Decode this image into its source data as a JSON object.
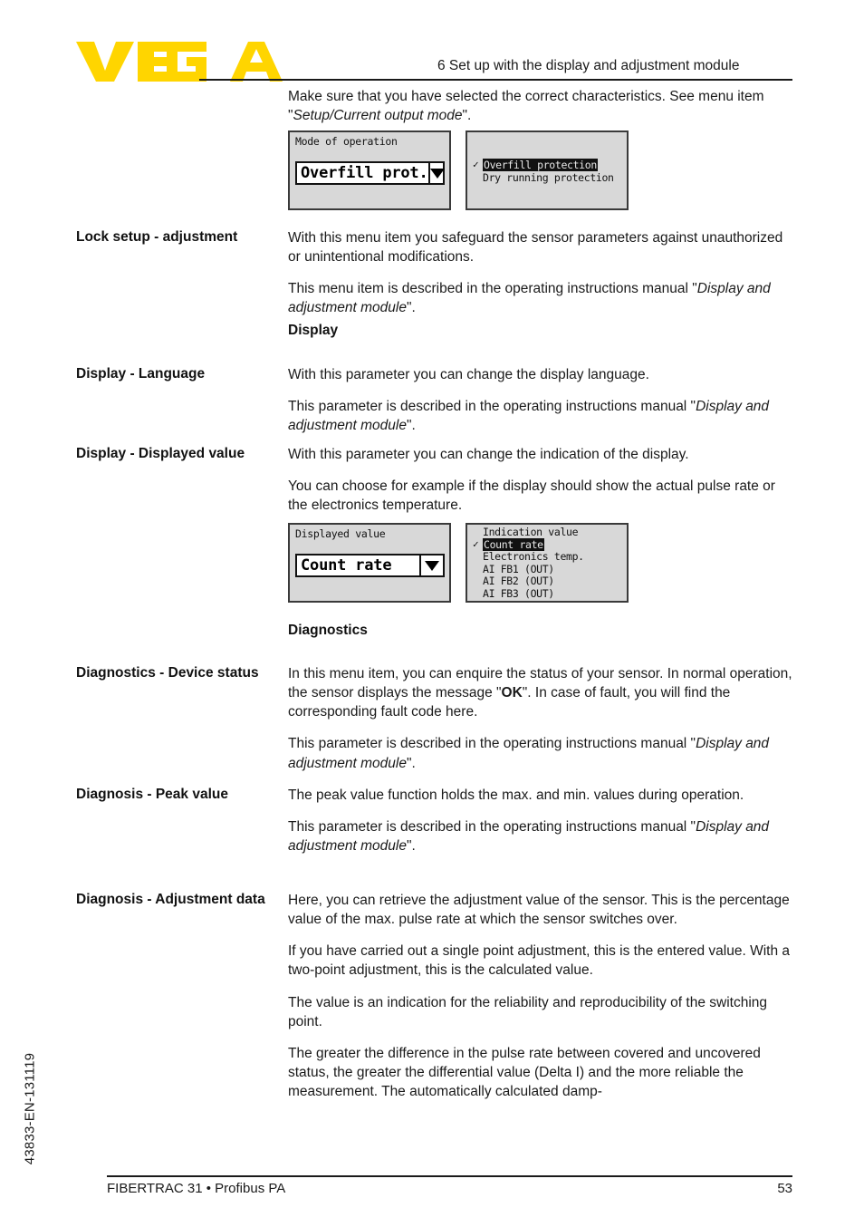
{
  "header": {
    "logo_text": "VEGA",
    "logo_color": "#FFD500",
    "chapter_title": "6 Set up with the display and adjustment module"
  },
  "intro": {
    "text_before": "Make sure that you have selected the correct characteristics. See menu item \"",
    "italic": "Setup/Current output mode",
    "text_after": "\"."
  },
  "lcd_1": {
    "left": {
      "title": "Mode of operation",
      "value": "Overfill prot.",
      "arrow_icon": "chevron-down-icon"
    },
    "right": {
      "items": [
        {
          "label": "Overfill protection",
          "selected": true,
          "checked": true
        },
        {
          "label": "Dry running protection",
          "selected": false,
          "checked": false
        }
      ]
    }
  },
  "sections": [
    {
      "label": "Lock setup - adjustment",
      "paragraphs": [
        {
          "text": "With this menu item you safeguard the sensor parameters against unauthorized or unintentional modifications."
        },
        {
          "pre": "This menu item is described in the operating instructions manual \"",
          "italic": "Display and adjustment module",
          "post": "\"."
        }
      ]
    }
  ],
  "display_heading": "Display",
  "display_language": {
    "label": "Display - Language",
    "p1": "With this parameter you can change the display language.",
    "p2_pre": "This parameter is described in the operating instructions manual \"",
    "p2_italic": "Display and adjustment module",
    "p2_post": "\"."
  },
  "displayed_value": {
    "label": "Display - Displayed value",
    "p1": "With this parameter you can change the indication of the display.",
    "p2": "You can choose for example if the display should show the actual pulse rate or the electronics temperature."
  },
  "lcd_2": {
    "left": {
      "title": "Displayed value",
      "value": "Count rate",
      "arrow_icon": "chevron-down-icon"
    },
    "right": {
      "title": "Indication value",
      "items": [
        {
          "label": "Count rate",
          "selected": true,
          "checked": true
        },
        {
          "label": "Electronics temp.",
          "selected": false,
          "checked": false
        },
        {
          "label": "AI FB1 (OUT)",
          "selected": false,
          "checked": false
        },
        {
          "label": "AI FB2 (OUT)",
          "selected": false,
          "checked": false
        },
        {
          "label": "AI FB3 (OUT)",
          "selected": false,
          "checked": false
        }
      ]
    }
  },
  "diagnostics_heading": "Diagnostics",
  "device_status": {
    "label": "Diagnostics - Device status",
    "p1_a": "In this menu item, you can enquire the status of your sensor. In normal operation, the sensor displays the message \"",
    "p1_bold": "OK",
    "p1_b": "\". In case of fault, you will find the corresponding fault code here.",
    "p2_pre": "This parameter is described in the operating instructions manual \"",
    "p2_italic": "Display and adjustment module",
    "p2_post": "\"."
  },
  "peak_value": {
    "label": "Diagnosis - Peak value",
    "p1": "The peak value function holds the max. and min. values during operation.",
    "p2_pre": "This parameter is described in the operating instructions manual \"",
    "p2_italic": "Display and adjustment module",
    "p2_post": "\"."
  },
  "adjustment_data": {
    "label": "Diagnosis - Adjustment data",
    "p1": "Here, you can retrieve the adjustment value of the sensor. This is the percentage value of the max. pulse rate at which the sensor switches over.",
    "p2": "If you have carried out a single point adjustment, this is the entered value. With a two-point adjustment, this is the calculated value.",
    "p3": "The value is an indication for the reliability and reproducibility of the switching point.",
    "p4": "The greater the difference in the pulse rate between covered and uncovered status, the greater the differential value (Delta I) and the more reliable the measurement. The automatically calculated damp-"
  },
  "footer": {
    "left": "FIBERTRAC 31 • Profibus PA",
    "page_number": "53",
    "doc_code": "43833-EN-131119"
  }
}
